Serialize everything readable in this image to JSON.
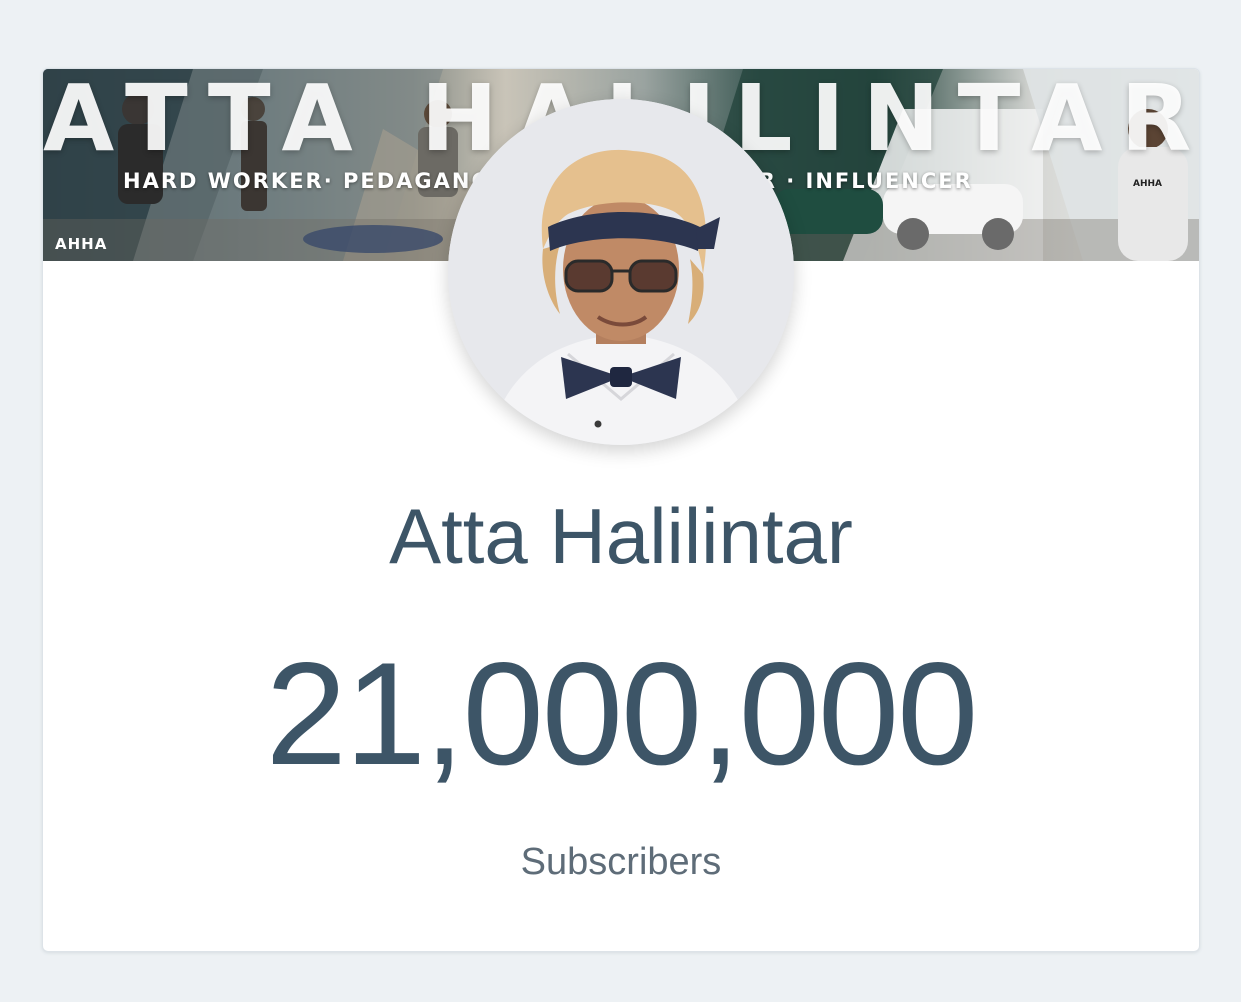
{
  "banner": {
    "title": "ATTA HALILINTAR",
    "tagline": "HARD WORKER· PEDAGANG · CONTENT CREATOR · INFLUENCER",
    "logo": "AHHA",
    "hoodie_logo": "AHHA"
  },
  "profile": {
    "name": "Atta Halilintar",
    "avatar_icon": "profile-photo"
  },
  "stats": {
    "subscriber_count": "21,000,000",
    "label": "Subscribers"
  },
  "colors": {
    "page_background": "#edf1f4",
    "card_background": "#ffffff",
    "text_primary": "#3d5567",
    "text_secondary": "#5e6c78"
  }
}
